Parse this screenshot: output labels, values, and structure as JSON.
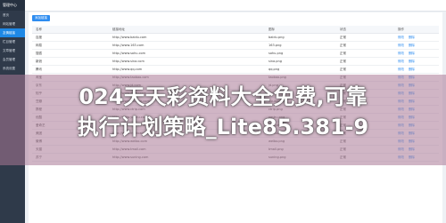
{
  "sidebar": {
    "brand": "管理中心",
    "items": [
      {
        "label": "首页",
        "active": false
      },
      {
        "label": "网站管理",
        "active": false
      },
      {
        "label": "友情链接",
        "active": true
      },
      {
        "label": "栏目管理",
        "active": false
      },
      {
        "label": "文章管理",
        "active": false
      },
      {
        "label": "会员管理",
        "active": false
      },
      {
        "label": "系统设置",
        "active": false
      }
    ]
  },
  "toolbar": {
    "add_label": "添加链接"
  },
  "table": {
    "headers": [
      "名称",
      "链接地址",
      "图标",
      "状态",
      "操作"
    ],
    "rows": [
      {
        "name": "百度",
        "url": "http://www.baidu.com",
        "icon": "baidu.png",
        "status": "正常",
        "actions": [
          "修改",
          "删除"
        ]
      },
      {
        "name": "网易",
        "url": "http://www.163.com",
        "icon": "163.png",
        "status": "正常",
        "actions": [
          "修改",
          "删除"
        ]
      },
      {
        "name": "搜狐",
        "url": "http://www.sohu.com",
        "icon": "sohu.png",
        "status": "正常",
        "actions": [
          "修改",
          "删除"
        ]
      },
      {
        "name": "新浪",
        "url": "http://www.sina.com",
        "icon": "sina.png",
        "status": "正常",
        "actions": [
          "修改",
          "删除"
        ]
      },
      {
        "name": "腾讯",
        "url": "http://www.qq.com",
        "icon": "qq.png",
        "status": "正常",
        "actions": [
          "修改",
          "删除"
        ]
      },
      {
        "name": "淘宝",
        "url": "http://www.taobao.com",
        "icon": "taobao.png",
        "status": "正常",
        "actions": [
          "修改",
          "删除"
        ]
      },
      {
        "name": "京东",
        "url": "http://www.jd.com",
        "icon": "jd.png",
        "status": "正常",
        "actions": [
          "修改",
          "删除"
        ]
      },
      {
        "name": "知乎",
        "url": "http://www.zhihu.com",
        "icon": "zhihu.png",
        "status": "正常",
        "actions": [
          "修改",
          "删除"
        ]
      },
      {
        "name": "豆瓣",
        "url": "http://www.douban.com",
        "icon": "douban.png",
        "status": "正常",
        "actions": [
          "修改",
          "删除"
        ]
      },
      {
        "name": "携程",
        "url": "http://www.ctrip.com",
        "icon": "ctrip.png",
        "status": "正常",
        "actions": [
          "修改",
          "删除"
        ]
      },
      {
        "name": "优酷",
        "url": "http://www.youku.com",
        "icon": "youku.png",
        "status": "正常",
        "actions": [
          "修改",
          "删除"
        ]
      },
      {
        "name": "爱奇艺",
        "url": "http://www.iqiyi.com",
        "icon": "iqiyi.png",
        "status": "正常",
        "actions": [
          "修改",
          "删除"
        ]
      },
      {
        "name": "美团",
        "url": "http://www.meituan.com",
        "icon": "meituan.png",
        "status": "正常",
        "actions": [
          "修改",
          "删除"
        ]
      },
      {
        "name": "微博",
        "url": "http://www.weibo.com",
        "icon": "weibo.png",
        "status": "正常",
        "actions": [
          "修改",
          "删除"
        ]
      },
      {
        "name": "天猫",
        "url": "http://www.tmall.com",
        "icon": "tmall.png",
        "status": "正常",
        "actions": [
          "修改",
          "删除"
        ]
      },
      {
        "name": "苏宁",
        "url": "http://www.suning.com",
        "icon": "suning.png",
        "status": "正常",
        "actions": [
          "修改",
          "删除"
        ]
      }
    ]
  },
  "banner": {
    "text": "024天天彩资料大全免费,可靠\n执行计划策略_Lite85.381-9"
  }
}
